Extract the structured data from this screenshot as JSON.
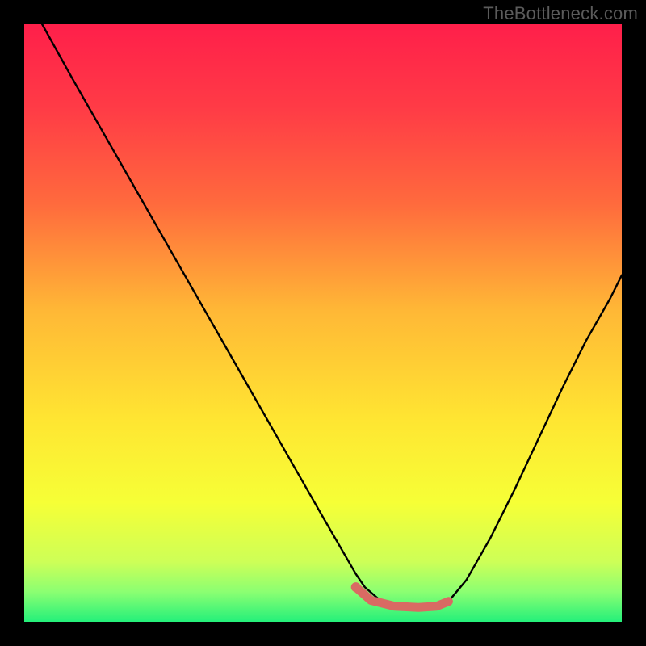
{
  "watermark": "TheBottleneck.com",
  "colors": {
    "gradient_stops": [
      {
        "pct": 0,
        "hex": "#ff1f4a"
      },
      {
        "pct": 14,
        "hex": "#ff3b46"
      },
      {
        "pct": 30,
        "hex": "#ff6a3d"
      },
      {
        "pct": 48,
        "hex": "#ffb836"
      },
      {
        "pct": 66,
        "hex": "#ffe532"
      },
      {
        "pct": 80,
        "hex": "#f6ff36"
      },
      {
        "pct": 90,
        "hex": "#cdff57"
      },
      {
        "pct": 95,
        "hex": "#8bff72"
      },
      {
        "pct": 100,
        "hex": "#24f07a"
      }
    ],
    "curve": "#000000",
    "marker": "#d96a63",
    "frame": "#000000"
  },
  "chart_data": {
    "type": "line",
    "title": "",
    "xlabel": "",
    "ylabel": "",
    "xlim": [
      0,
      100
    ],
    "ylim": [
      0,
      100
    ],
    "grid": false,
    "series": [
      {
        "name": "black-curve",
        "x": [
          3,
          8,
          14,
          20,
          26,
          32,
          38,
          44,
          50,
          55.5,
          57,
          60,
          64,
          68,
          70,
          71,
          74,
          78,
          82,
          86,
          90,
          94,
          98,
          100
        ],
        "y": [
          100,
          91,
          80.5,
          70,
          59.5,
          49,
          38.5,
          28,
          17.5,
          8,
          5.8,
          3.2,
          2.2,
          2.2,
          2.6,
          3.4,
          7,
          14,
          22,
          30.5,
          39,
          47,
          54,
          58
        ]
      },
      {
        "name": "highlight-segment",
        "x": [
          55.5,
          58,
          62,
          66,
          69,
          71
        ],
        "y": [
          5.8,
          3.6,
          2.6,
          2.4,
          2.6,
          3.4
        ]
      }
    ],
    "markers": [
      {
        "name": "start-dot",
        "x": 55.5,
        "y": 5.8
      }
    ]
  }
}
